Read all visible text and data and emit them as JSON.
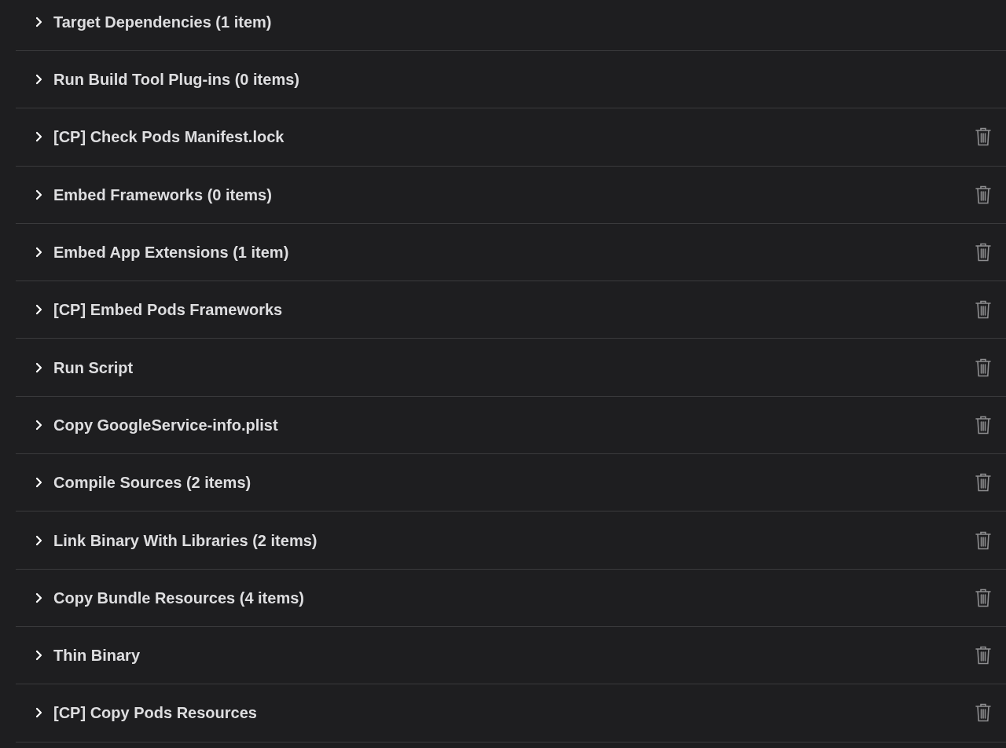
{
  "build_phases": [
    {
      "title": "Target Dependencies (1 item)",
      "expanded": false,
      "deletable": false
    },
    {
      "title": "Run Build Tool Plug-ins (0 items)",
      "expanded": false,
      "deletable": false
    },
    {
      "title": "[CP] Check Pods Manifest.lock",
      "expanded": false,
      "deletable": true
    },
    {
      "title": "Embed Frameworks (0 items)",
      "expanded": false,
      "deletable": true
    },
    {
      "title": "Embed App Extensions (1 item)",
      "expanded": false,
      "deletable": true
    },
    {
      "title": "[CP] Embed Pods Frameworks",
      "expanded": false,
      "deletable": true
    },
    {
      "title": "Run Script",
      "expanded": false,
      "deletable": true
    },
    {
      "title": "Copy GoogleService-info.plist",
      "expanded": false,
      "deletable": true
    },
    {
      "title": "Compile Sources (2 items)",
      "expanded": false,
      "deletable": true
    },
    {
      "title": "Link Binary With Libraries (2 items)",
      "expanded": false,
      "deletable": true
    },
    {
      "title": "Copy Bundle Resources (4 items)",
      "expanded": false,
      "deletable": true
    },
    {
      "title": "Thin Binary",
      "expanded": false,
      "deletable": true
    },
    {
      "title": "[CP] Copy Pods Resources",
      "expanded": false,
      "deletable": true
    }
  ]
}
